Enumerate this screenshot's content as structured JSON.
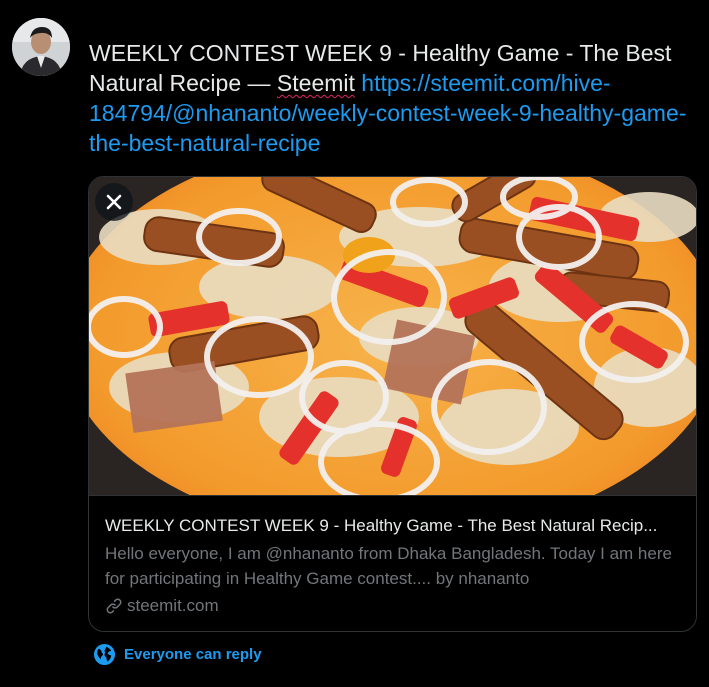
{
  "tweet": {
    "text_plain": "WEEKLY CONTEST WEEK 9 - Healthy Game - The Best Natural Recipe — ",
    "steemit_word": "Steemit",
    "link_text": "https://steemit.com/hive-184794/@nhananto/weekly-contest-week-9-healthy-game-the-best-natural-recipe"
  },
  "card": {
    "title": "WEEKLY CONTEST WEEK 9 - Healthy Game - The Best Natural Recip...",
    "description": "Hello everyone, I am @nhananto from Dhaka Bangladesh. Today I am here for participating in Healthy Game contest.... by nhananto",
    "domain": "steemit.com",
    "close_icon": "close-icon",
    "image_subject": "pizza with onion rings, tomatoes, sausages and cheese"
  },
  "reply": {
    "label": "Everyone can reply",
    "icon": "globe-icon"
  },
  "colors": {
    "background": "#000000",
    "text": "#e7e9ea",
    "muted": "#71767b",
    "accent": "#1d9bf0",
    "border": "#2f3336"
  }
}
